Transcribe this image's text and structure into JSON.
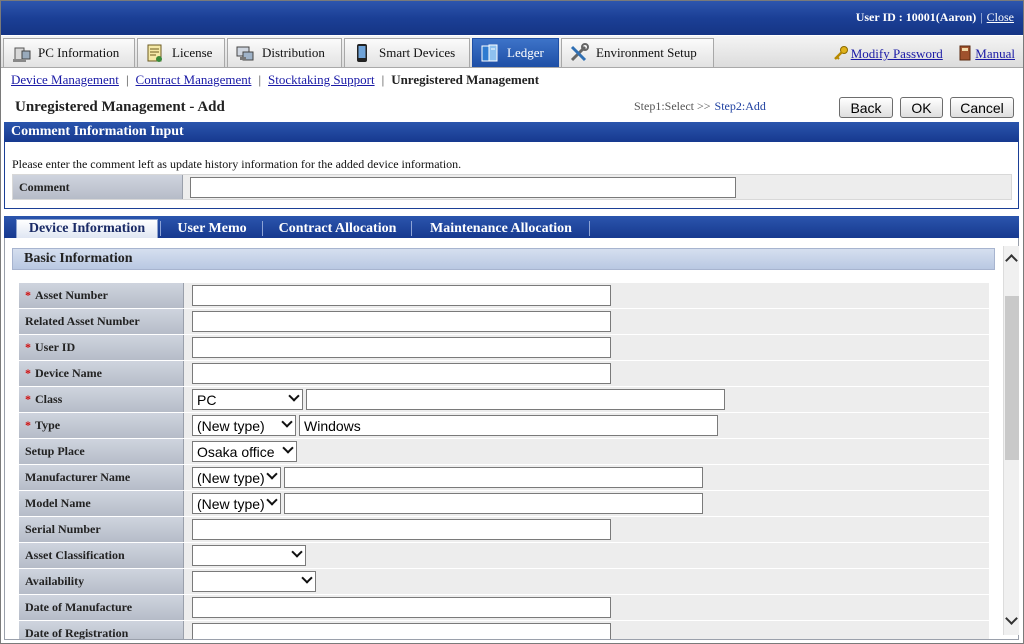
{
  "header": {
    "user_label": "User ID : 10001(Aaron)",
    "separator": "|",
    "close_label": "Close"
  },
  "main_tabs": [
    {
      "label": "PC Information",
      "icon": "pc-icon"
    },
    {
      "label": "License",
      "icon": "license-icon"
    },
    {
      "label": "Distribution",
      "icon": "distribution-icon"
    },
    {
      "label": "Smart Devices",
      "icon": "smart-device-icon"
    },
    {
      "label": "Ledger",
      "icon": "ledger-icon",
      "active": true
    },
    {
      "label": "Environment Setup",
      "icon": "tools-icon"
    }
  ],
  "links": {
    "modify_password": "Modify Password",
    "manual": "Manual"
  },
  "breadcrumb": {
    "items": [
      "Device Management",
      "Contract Management",
      "Stocktaking Support"
    ],
    "current": "Unregistered Management",
    "separator": "|"
  },
  "page": {
    "title": "Unregistered Management - Add",
    "step1": "Step1:Select >>",
    "step2": "Step2:Add",
    "back_label": "Back",
    "ok_label": "OK",
    "cancel_label": "Cancel"
  },
  "comment_section": {
    "title": "Comment Information Input",
    "hint": "Please enter the comment left as update history information for the added device information.",
    "comment_label": "Comment",
    "comment_value": ""
  },
  "sub_tabs": [
    "Device Information",
    "User Memo",
    "Contract Allocation",
    "Maintenance Allocation"
  ],
  "basic_info": {
    "title": "Basic Information",
    "required_mark": "*",
    "fields": {
      "asset_number": "Asset Number",
      "related_asset_number": "Related Asset Number",
      "user_id": "User ID",
      "device_name": "Device Name",
      "class": "Class",
      "class_select": "PC",
      "type": "Type",
      "type_select": "(New type)",
      "type_value": "Windows",
      "setup_place": "Setup Place",
      "setup_place_select": "Osaka office",
      "manufacturer_name": "Manufacturer Name",
      "manufacturer_select": "(New type)",
      "model_name": "Model Name",
      "model_select": "(New type)",
      "serial_number": "Serial Number",
      "asset_classification": "Asset Classification",
      "availability": "Availability",
      "date_of_manufacture": "Date of Manufacture",
      "date_of_registration": "Date of Registration"
    }
  }
}
